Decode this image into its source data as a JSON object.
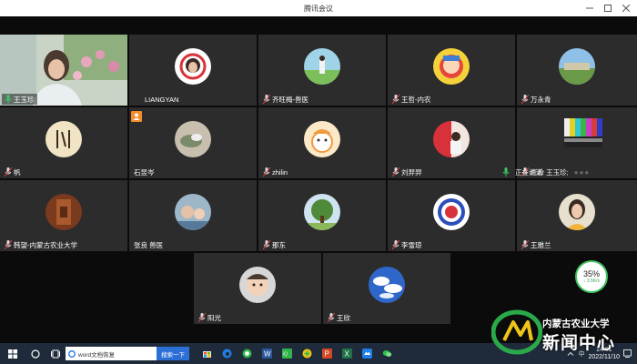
{
  "window": {
    "title": "腾讯会议"
  },
  "speaker_tile": {
    "name": "王玉珍",
    "corner_label": ""
  },
  "participants": [
    {
      "name": "LIANGYAN"
    },
    {
      "name": "齐旺梅-兽医"
    },
    {
      "name": "王哲-内农"
    },
    {
      "name": "万永青"
    },
    {
      "name": "帆"
    },
    {
      "name": "石昱岑"
    },
    {
      "name": "zhilin"
    },
    {
      "name": "刘羿羿"
    },
    {
      "name": "红岭"
    },
    {
      "name": "韩望-内蒙古农业大学"
    },
    {
      "name": "张良 兽医"
    },
    {
      "name": "那东"
    },
    {
      "name": "李雪琼"
    },
    {
      "name": "王雅兰"
    },
    {
      "name": "阳光"
    },
    {
      "name": "王欣"
    }
  ],
  "talking": {
    "label": "正在讲话: 王玉珍;"
  },
  "network": {
    "percent": "35%",
    "rate": "↓ 3.5K/s"
  },
  "taskbar": {
    "search_value": "word文档恢复",
    "search_button": "搜索一下",
    "ime": "中",
    "time": "14:01",
    "date": "2022/11/10"
  },
  "watermark": {
    "line1": "内蒙古农业大学",
    "line2": "新闻中心"
  },
  "colors": {
    "tile_bg": "#2c2c2c",
    "host_badge": "#f58c2a",
    "taskbar": "#1f2b3a",
    "net_green": "#3cc561"
  }
}
